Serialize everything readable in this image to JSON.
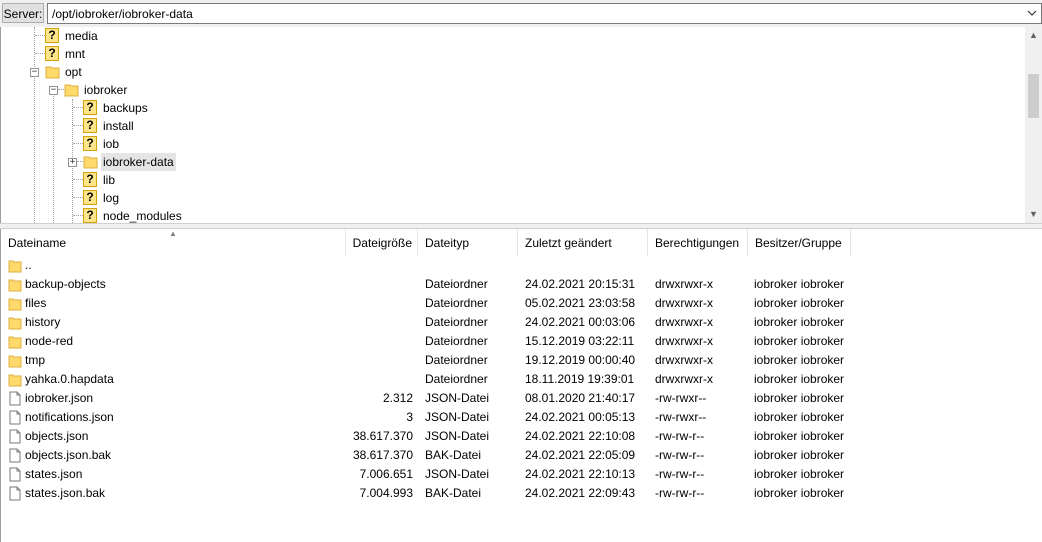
{
  "server": {
    "label": "Server:",
    "path": "/opt/iobroker/iobroker-data"
  },
  "tree": {
    "items": [
      {
        "label": "media",
        "icon": "question-folder-icon"
      },
      {
        "label": "mnt",
        "icon": "question-folder-icon"
      },
      {
        "label": "opt",
        "icon": "folder-icon",
        "expanded": true
      },
      {
        "label": "iobroker",
        "icon": "folder-icon",
        "expanded": true
      },
      {
        "label": "backups",
        "icon": "question-folder-icon"
      },
      {
        "label": "install",
        "icon": "question-folder-icon"
      },
      {
        "label": "iob",
        "icon": "question-folder-icon"
      },
      {
        "label": "iobroker-data",
        "icon": "folder-icon",
        "selected": true
      },
      {
        "label": "lib",
        "icon": "question-folder-icon"
      },
      {
        "label": "log",
        "icon": "question-folder-icon"
      },
      {
        "label": "node_modules",
        "icon": "question-folder-icon"
      }
    ]
  },
  "list": {
    "columns": {
      "name": "Dateiname",
      "size": "Dateigröße",
      "type": "Dateityp",
      "modified": "Zuletzt geändert",
      "perms": "Berechtigungen",
      "owner": "Besitzer/Gruppe"
    },
    "rows": [
      {
        "name": "..",
        "size": "",
        "type": "",
        "modified": "",
        "perms": "",
        "owner": "",
        "kind": "folder"
      },
      {
        "name": "backup-objects",
        "size": "",
        "type": "Dateiordner",
        "modified": "24.02.2021 20:15:31",
        "perms": "drwxrwxr-x",
        "owner": "iobroker iobroker",
        "kind": "folder"
      },
      {
        "name": "files",
        "size": "",
        "type": "Dateiordner",
        "modified": "05.02.2021 23:03:58",
        "perms": "drwxrwxr-x",
        "owner": "iobroker iobroker",
        "kind": "folder"
      },
      {
        "name": "history",
        "size": "",
        "type": "Dateiordner",
        "modified": "24.02.2021 00:03:06",
        "perms": "drwxrwxr-x",
        "owner": "iobroker iobroker",
        "kind": "folder"
      },
      {
        "name": "node-red",
        "size": "",
        "type": "Dateiordner",
        "modified": "15.12.2019 03:22:11",
        "perms": "drwxrwxr-x",
        "owner": "iobroker iobroker",
        "kind": "folder"
      },
      {
        "name": "tmp",
        "size": "",
        "type": "Dateiordner",
        "modified": "19.12.2019 00:00:40",
        "perms": "drwxrwxr-x",
        "owner": "iobroker iobroker",
        "kind": "folder"
      },
      {
        "name": "yahka.0.hapdata",
        "size": "",
        "type": "Dateiordner",
        "modified": "18.11.2019 19:39:01",
        "perms": "drwxrwxr-x",
        "owner": "iobroker iobroker",
        "kind": "folder"
      },
      {
        "name": "iobroker.json",
        "size": "2.312",
        "type": "JSON-Datei",
        "modified": "08.01.2020 21:40:17",
        "perms": "-rw-rwxr--",
        "owner": "iobroker iobroker",
        "kind": "file"
      },
      {
        "name": "notifications.json",
        "size": "3",
        "type": "JSON-Datei",
        "modified": "24.02.2021 00:05:13",
        "perms": "-rw-rwxr--",
        "owner": "iobroker iobroker",
        "kind": "file"
      },
      {
        "name": "objects.json",
        "size": "38.617.370",
        "type": "JSON-Datei",
        "modified": "24.02.2021 22:10:08",
        "perms": "-rw-rw-r--",
        "owner": "iobroker iobroker",
        "kind": "file"
      },
      {
        "name": "objects.json.bak",
        "size": "38.617.370",
        "type": "BAK-Datei",
        "modified": "24.02.2021 22:05:09",
        "perms": "-rw-rw-r--",
        "owner": "iobroker iobroker",
        "kind": "file"
      },
      {
        "name": "states.json",
        "size": "7.006.651",
        "type": "JSON-Datei",
        "modified": "24.02.2021 22:10:13",
        "perms": "-rw-rw-r--",
        "owner": "iobroker iobroker",
        "kind": "file"
      },
      {
        "name": "states.json.bak",
        "size": "7.004.993",
        "type": "BAK-Datei",
        "modified": "24.02.2021 22:09:43",
        "perms": "-rw-rw-r--",
        "owner": "iobroker iobroker",
        "kind": "file"
      }
    ]
  }
}
